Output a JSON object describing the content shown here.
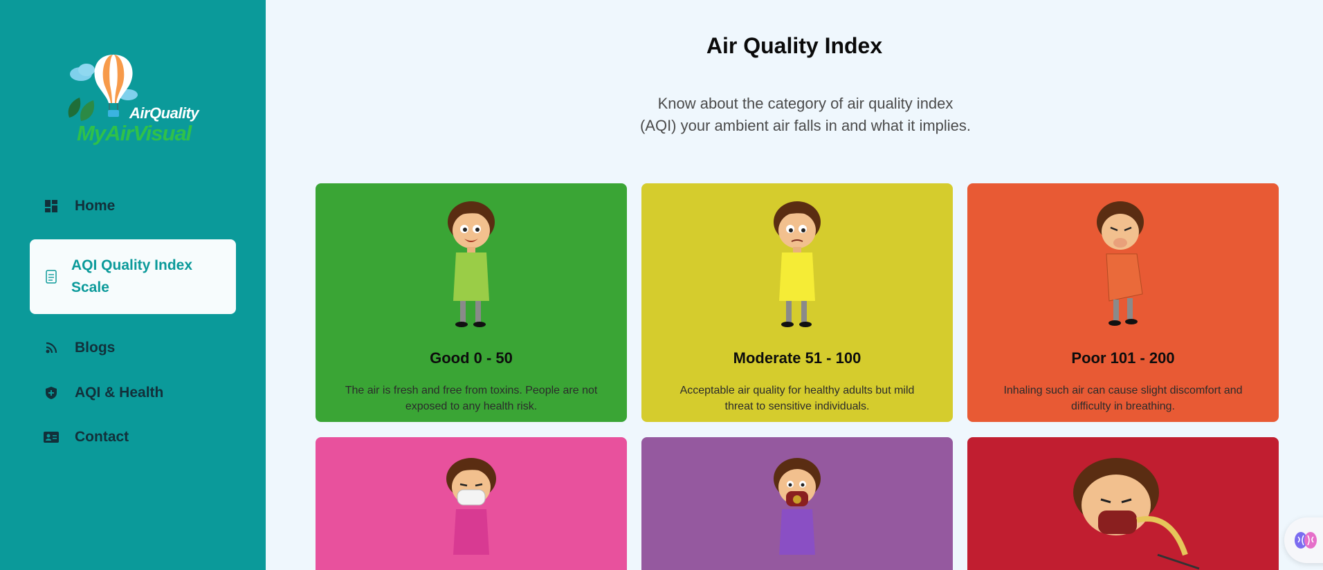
{
  "brand": {
    "line1": "AirQuality",
    "line2": "MyAirVisual",
    "colors": {
      "sidebar": "#0b9a9a",
      "accent_green": "#2fc14a"
    }
  },
  "nav": {
    "items": [
      {
        "label": "Home",
        "icon": "dashboard-icon"
      },
      {
        "label": "AQI Quality Index Scale",
        "label_line1": "AQI Quality Index",
        "label_line2": "Scale",
        "icon": "document-icon",
        "active": true
      },
      {
        "label": "Blogs",
        "icon": "rss-icon"
      },
      {
        "label": "AQI & Health",
        "icon": "shield-plus-icon"
      },
      {
        "label": "Contact",
        "icon": "contact-card-icon"
      }
    ]
  },
  "header": {
    "title": "Air Quality Index",
    "subtitle_line1": "Know about the category of air quality index",
    "subtitle_line2": "(AQI) your ambient air falls in and what it implies."
  },
  "cards": [
    {
      "title": "Good 0 - 50",
      "desc": "The air is fresh and free from toxins. People are not exposed to any health risk.",
      "color": "#3aa535",
      "icon": "happy-boy-icon"
    },
    {
      "title": "Moderate 51 - 100",
      "desc": "Acceptable air quality for healthy adults but mild threat to sensitive individuals.",
      "color": "#d5cc2d",
      "icon": "worried-boy-icon"
    },
    {
      "title": "Poor 101 - 200",
      "desc": "Inhaling such air can cause slight discomfort and difficulty in breathing.",
      "color": "#e85a34",
      "icon": "coughing-boy-icon"
    },
    {
      "title": "",
      "desc": "",
      "color": "#e8519d",
      "icon": "masked-boy-icon"
    },
    {
      "title": "",
      "desc": "",
      "color": "#95599f",
      "icon": "gas-mask-boy-icon"
    },
    {
      "title": "",
      "desc": "",
      "color": "#c11e30",
      "icon": "oxygen-mask-boy-icon"
    }
  ],
  "assistant": {
    "icon": "brain-icon"
  }
}
